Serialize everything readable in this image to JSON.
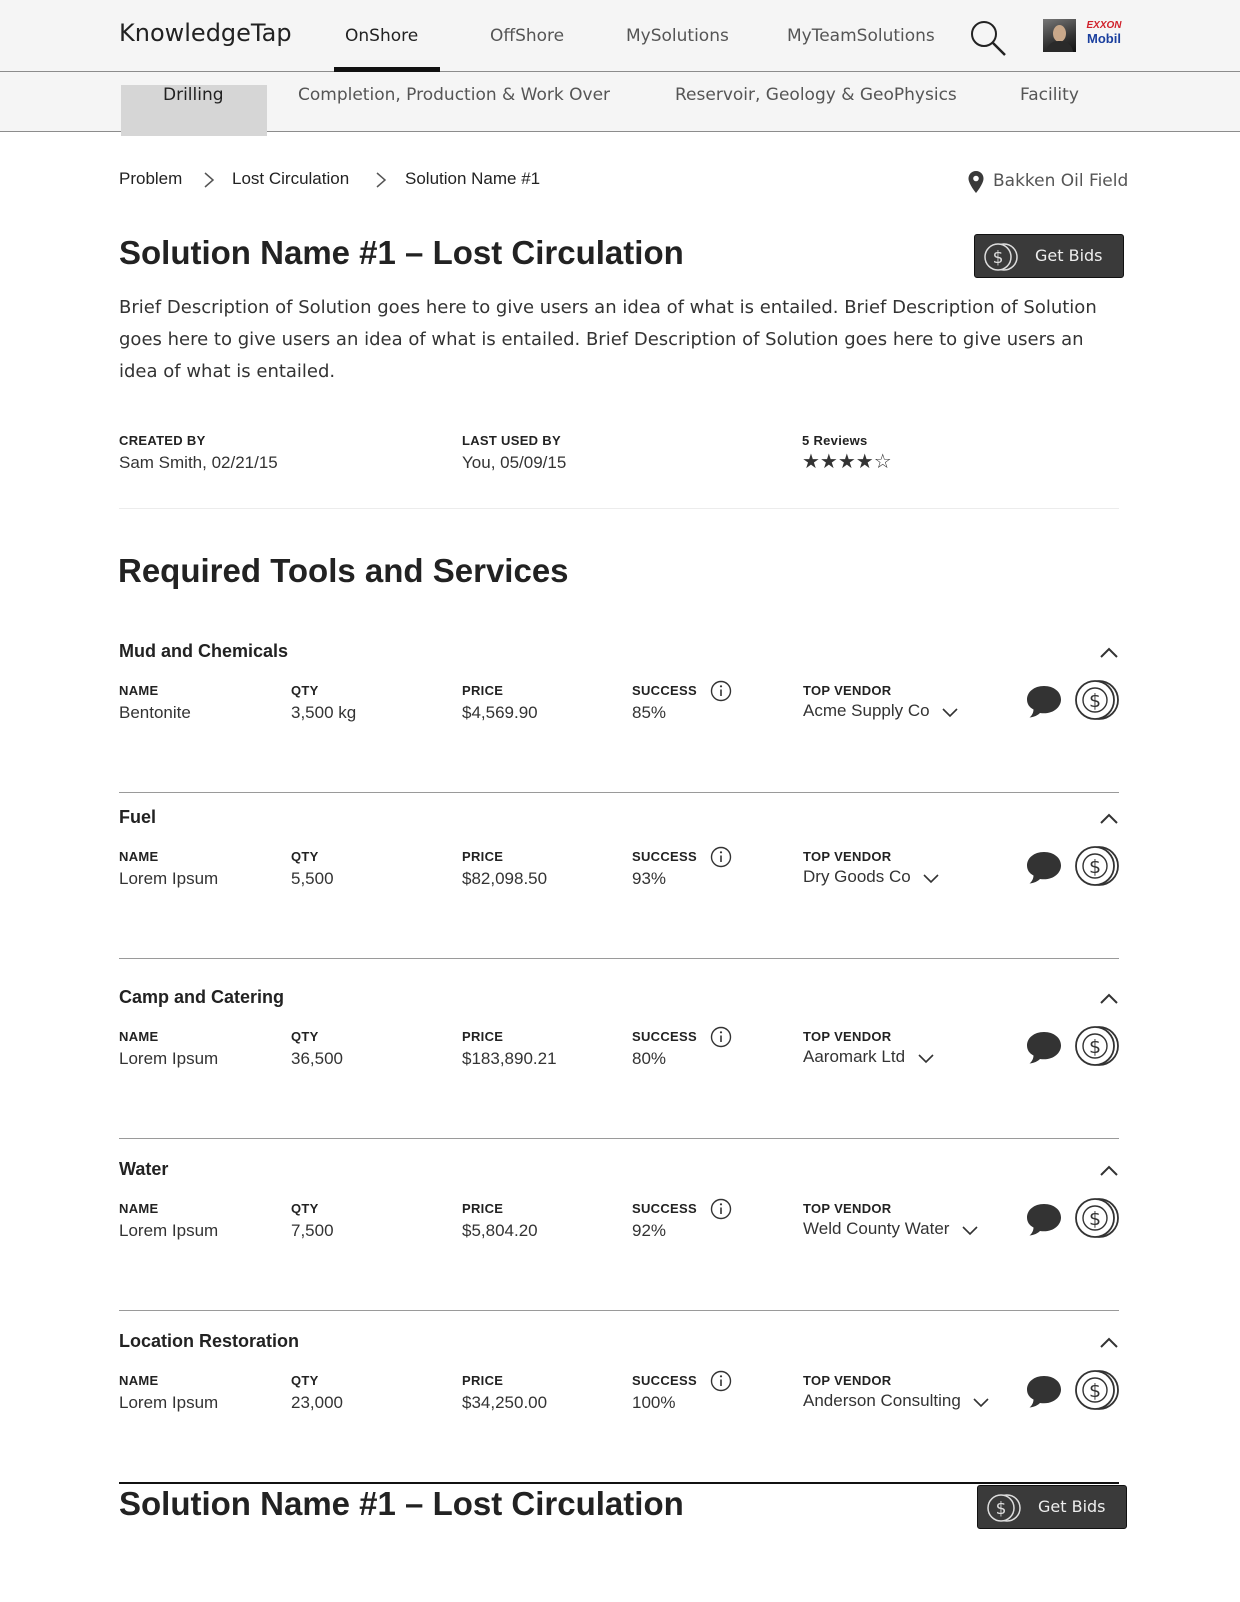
{
  "header": {
    "brand": "KnowledgeTap",
    "nav": [
      "OnShore",
      "OffShore",
      "MySolutions",
      "MyTeamSolutions"
    ],
    "active_nav": "OnShore",
    "company_logo": {
      "line1": "EXXON",
      "line2": "Mobil"
    },
    "icons": [
      "search-icon",
      "user-avatar",
      "company-logo"
    ]
  },
  "subnav": {
    "items": [
      "Drilling",
      "Completion, Production & Work Over",
      "Reservoir, Geology & GeoPhysics",
      "Facility"
    ],
    "active": "Drilling"
  },
  "breadcrumb": {
    "items": [
      "Problem",
      "Lost Circulation",
      "Solution Name #1"
    ],
    "location": "Bakken Oil Field"
  },
  "solution": {
    "title": "Solution Name #1 – Lost Circulation",
    "get_bids_label": "Get Bids",
    "description": "Brief Description of Solution goes here to give users an idea of what is entailed. Brief Description of Solution goes here to give users an idea of what is entailed. Brief Description of Solution goes here to give users an idea of what is entailed.",
    "created_by_label": "CREATED BY",
    "created_by_value": "Sam Smith, 02/21/15",
    "last_used_label": "LAST USED BY",
    "last_used_value": "You, 05/09/15",
    "reviews_label": "5 Reviews",
    "rating": 4,
    "rating_max": 5,
    "rating_display": "★★★★☆"
  },
  "tools_section": {
    "title": "Required Tools and Services",
    "labels": {
      "name": "NAME",
      "qty": "QTY",
      "price": "PRICE",
      "success": "SUCCESS",
      "vendor": "TOP VENDOR"
    },
    "groups": [
      {
        "title": "Mud and Chemicals",
        "name": "Bentonite",
        "qty": "3,500 kg",
        "price": "$4,569.90",
        "success": "85%",
        "vendor": "Acme Supply Co"
      },
      {
        "title": "Fuel",
        "name": "Lorem Ipsum",
        "qty": "5,500",
        "price": "$82,098.50",
        "success": "93%",
        "vendor": "Dry Goods Co"
      },
      {
        "title": "Camp and Catering",
        "name": "Lorem Ipsum",
        "qty": "36,500",
        "price": "$183,890.21",
        "success": "80%",
        "vendor": "Aaromark Ltd"
      },
      {
        "title": "Water",
        "name": "Lorem Ipsum",
        "qty": "7,500",
        "price": "$5,804.20",
        "success": "92%",
        "vendor": "Weld County Water"
      },
      {
        "title": "Location Restoration",
        "name": "Lorem Ipsum",
        "qty": "23,000",
        "price": "$34,250.00",
        "success": "100%",
        "vendor": "Anderson Consulting"
      }
    ]
  },
  "footer_solution": {
    "title": "Solution Name #1 – Lost Circulation",
    "get_bids_label": "Get Bids"
  },
  "colors": {
    "button_bg": "#3a3a3a",
    "active_tab_underline": "#111111",
    "subnav_active_bg": "#d6d6d6",
    "bar_bg": "#f5f5f5"
  }
}
